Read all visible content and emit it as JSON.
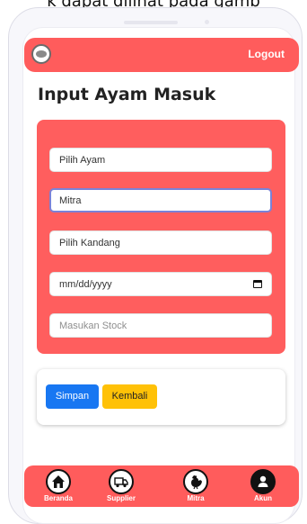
{
  "caption": "k dapat dilihat pada gamb",
  "header": {
    "logout_label": "Logout"
  },
  "page": {
    "title": "Input Ayam Masuk"
  },
  "form": {
    "chicken_select": "Pilih Ayam",
    "partner_select": "Mitra",
    "cage_select": "Pilih Kandang",
    "date_input": "mm/dd/yyyy",
    "stock_input_placeholder": "Masukan Stock"
  },
  "actions": {
    "save_label": "Simpan",
    "back_label": "Kembali"
  },
  "bottom_nav": {
    "items": [
      {
        "label": "Beranda",
        "icon": "home-icon"
      },
      {
        "label": "Supplier",
        "icon": "truck-icon"
      },
      {
        "label": "Mitra",
        "icon": "rooster-icon"
      },
      {
        "label": "Akun",
        "icon": "user-icon"
      }
    ]
  },
  "colors": {
    "accent": "#ff5c5c",
    "primary_button": "#1877f2",
    "warning_button": "#ffc107"
  }
}
